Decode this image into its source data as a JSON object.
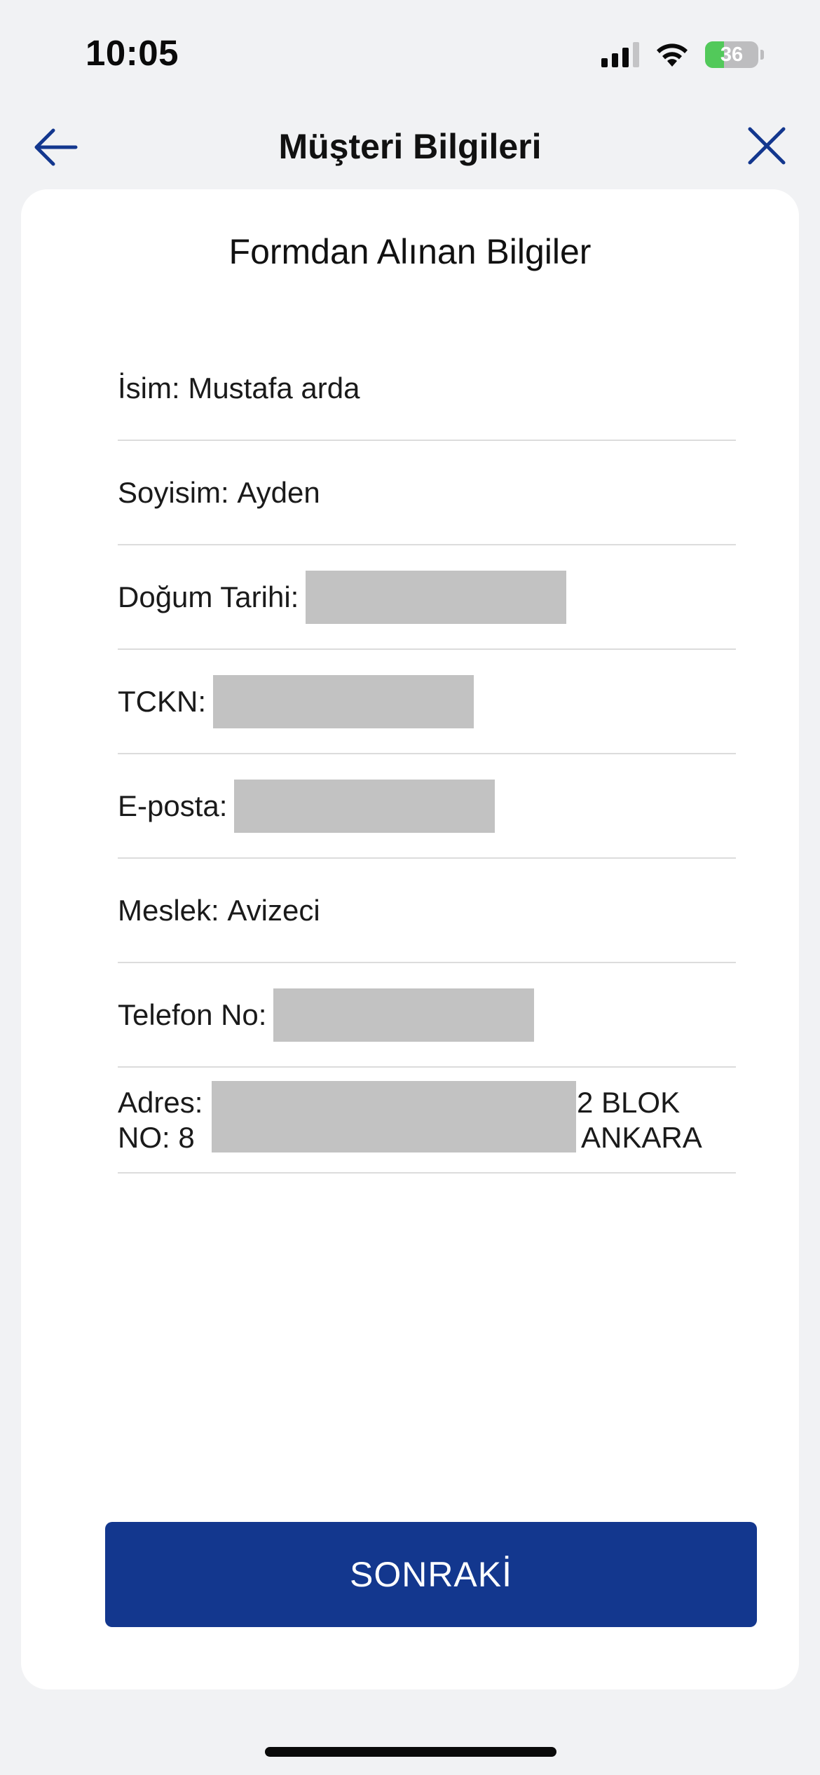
{
  "status_bar": {
    "time": "10:05",
    "battery": "36",
    "battery_level_percent": 36
  },
  "header": {
    "title": "Müşteri Bilgileri",
    "back_icon": "arrow-left-icon",
    "close_icon": "close-icon"
  },
  "card": {
    "title": "Formdan Alınan Bilgiler",
    "fields": {
      "name": {
        "label": "İsim: ",
        "value": "Mustafa arda"
      },
      "surname": {
        "label": "Soyisim: ",
        "value": "Ayden"
      },
      "birth_date": {
        "label": "Doğum Tarihi:"
      },
      "tckn": {
        "label": "TCKN:"
      },
      "email": {
        "label": "E-posta:"
      },
      "occupation": {
        "label": "Meslek: ",
        "value": "Avizeci"
      },
      "phone": {
        "label": "Telefon No:"
      },
      "address": {
        "line1_left": "Adres:",
        "line1_right": "2 BLOK",
        "line2_left": "NO: 8",
        "line2_right": "ANKARA"
      }
    }
  },
  "actions": {
    "next_label": "SONRAKİ"
  },
  "colors": {
    "accent": "#13378e",
    "background": "#f1f2f4",
    "redaction": "#c2c2c2"
  }
}
